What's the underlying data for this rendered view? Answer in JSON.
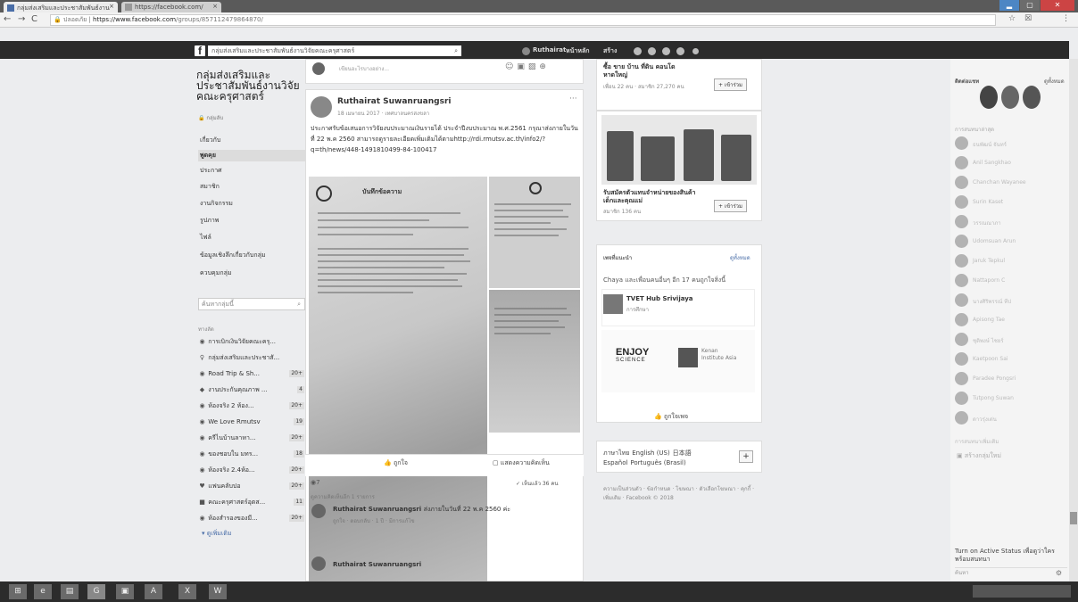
{
  "browser": {
    "tabs": [
      "กลุ่มส่งเสริมและประชาสัมพันธ์งาน",
      "https://facebook.com/"
    ],
    "tab_close": "×",
    "window_controls": [
      "▂",
      "▢",
      "✕"
    ],
    "url_secure": "ปลอดภัย",
    "url_host": "https://www.facebook.com",
    "url_path": "/groups/857112479864870/",
    "nav": [
      "←",
      "→",
      "C"
    ],
    "addr_icons": [
      "☆",
      "☒",
      "⋮"
    ]
  },
  "fb_header": {
    "logo": "f",
    "search_value": "กลุ่มส่งเสริมและประชาสัมพันธ์งานวิจัยคณะครุศาสตร์",
    "search_icon": "⌕",
    "user_name": "Ruthairat",
    "home": "หน้าหลัก",
    "create": "สร้าง"
  },
  "left": {
    "group_title": "กลุ่มส่งเสริมและประชาสัมพันธ์งานวิจัยคณะครุศาสตร์",
    "group_type": "กลุ่มลับ",
    "nav": [
      "เกี่ยวกับ",
      "พูดคุย",
      "ประกาศ",
      "สมาชิก",
      "งานกิจกรรม",
      "รูปภาพ",
      "ไฟล์",
      "ข้อมูลเชิงลึกเกี่ยวกับกลุ่ม",
      "ควบคุมกลุ่ม"
    ],
    "selected_nav": "พูดคุย",
    "search_placeholder": "ค้นหากลุ่มนี้",
    "shortcuts_heading": "ทางลัด",
    "shortcuts": [
      {
        "label": "การเบิกเงินวิจัยคณะครุ...",
        "count": ""
      },
      {
        "label": "กลุ่มส่งเสริมและประชาสั...",
        "count": ""
      },
      {
        "label": "Road Trip & Sh...",
        "count": "20+"
      },
      {
        "label": "งานประกันคุณภาพ ...",
        "count": "4"
      },
      {
        "label": "ห้องจริง 2 ห้อง...",
        "count": "20+"
      },
      {
        "label": "We Love Rmutsv",
        "count": "19"
      },
      {
        "label": "ครีไนบ้านลาหา...",
        "count": "20+"
      },
      {
        "label": "ของชอบใน มทร...",
        "count": "18"
      },
      {
        "label": "ห้องจริง 2.4ห้อ...",
        "count": "20+"
      },
      {
        "label": "แฟนคลับปอ",
        "count": "20+"
      },
      {
        "label": "คณะครุศาสตร์อุตส...",
        "count": "11"
      },
      {
        "label": "ห้องสำรองของมี...",
        "count": "20+"
      }
    ],
    "see_more": "ดูเพิ่มเติม"
  },
  "composer": {
    "placeholder": "เขียนอะไรบางอย่าง...",
    "icons": [
      "☺",
      "▣",
      "▨",
      "⊕"
    ]
  },
  "post": {
    "author": "Ruthairat Suwanruangsri",
    "date": "18 เมษายน 2017 · เทศบาลนครสงขลา",
    "more": "···",
    "text": "ประกาศรับข้อเสนอการวิจัยงบประมาณเงินรายได้ ประจำปีงบประมาณ พ.ศ.2561 กรุณาส่งภายในวันที่ 22 พ.ค 2560 สามารถดูรายละเอียดเพิ่มเติมได้ตามhttp://rdi.rmutsv.ac.th/info2/?q=th/news/448-1491810499-84-100417",
    "doc_heading": "บันทึกข้อความ",
    "like": "ถูกใจ",
    "comment": "แสดงความคิดเห็น",
    "like_count": "7",
    "seen": "✓ เห็นแล้ว 36 คน",
    "more_comments": "ดูความคิดเห็นอีก 1 รายการ",
    "comment1_author": "Ruthairat Suwanruangsri",
    "comment1_text": "ส่งภายในวันที่ 22 พ.ค 2560 ค่ะ",
    "comment1_meta": "ถูกใจ · ตอบกลับ · 1 ปี · มีการแก้ไข",
    "comment2_author": "Ruthairat Suwanruangsri"
  },
  "right": {
    "sugg1_text": "ซื้อ ขาย บ้าน ที่ดิน คอนโด หาดใหญ่",
    "sugg1_meta": "เพื่อน 22 คน · สมาชิก 27,270 คน",
    "join": "+ เข้าร่วม",
    "sugg2_text": "รับสมัครตัวแทนจำหน่ายของสินค้าเด็กและคุณแม่",
    "sugg2_meta": "สมาชิก 136 คน",
    "pages_heading": "เพจที่แนะนำ",
    "see_all": "ดูทั้งหมด",
    "page_like_line": "Chaya และเพื่อนคนอื่นๆ อีก 17 คนถูกใจสิ่งนี้",
    "page_name": "TVET Hub Srivijaya",
    "page_type": "การศึกษา",
    "enjoy": "ENJOY",
    "enjoy_sub": "SCIENCE",
    "kenan": "Kenan Institute Asia",
    "like_page": "ถูกใจเพจ",
    "languages": [
      "ภาษาไทย",
      "English (US)",
      "日本語",
      "Español",
      "Português (Brasil)"
    ],
    "lang_add": "+",
    "footer": "ความเป็นส่วนตัว · ข้อกำหนด · โฆษณา · ตัวเลือกโฆษณา · คุกกี้ · เพิ่มเติม · Facebook © 2018"
  },
  "chat": {
    "heading": "ติดต่อแชท",
    "groups": "ดูทั้งหมด",
    "section": "การสนทนาล่าสุด",
    "contacts": [
      "ธนพัฒน์ จันทร์",
      "Anil Sangkhao",
      "Chanchan Wayanee",
      "Surin Kaset",
      "วรรณณาภา",
      "Udomsuan Arun",
      "Jaruk Tepkul",
      "Nattaporn C",
      "นางศิริพรรณ์ ทีป",
      "Apisong Tae",
      "ชุติพงษ์ ไชยร์",
      "Kaetpoon Sai",
      "Paradee Pongsri",
      "Tutpong Suwan",
      "ดาวรุ่งเด่น"
    ],
    "more_label": "การสนทนาเพิ่มเติม",
    "create_group": "สร้างกลุ่มใหม่",
    "turn_on": "Turn on Active Status เพื่อดูว่าใครพร้อมสนทนา",
    "search": "ค้นหา"
  },
  "taskbar": {
    "icons": [
      "⊞",
      "e",
      "▤",
      "G",
      "▣",
      "A",
      "X",
      "W"
    ]
  }
}
